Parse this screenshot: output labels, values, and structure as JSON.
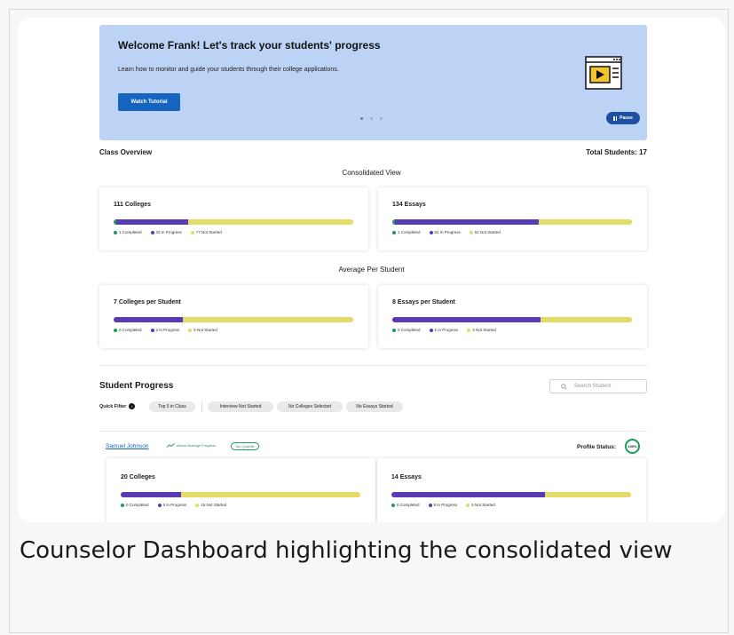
{
  "banner": {
    "title": "Welcome Frank! Let's track your students' progress",
    "text": "Learn how to monitor and guide your students through their college applications.",
    "tutorial_button": "Watch Tutorial",
    "pause_button": "Pause"
  },
  "class_overview": {
    "title": "Class Overview",
    "total_students": "Total Students: 17"
  },
  "consolidated": {
    "heading": "Consolidated View",
    "colleges": {
      "title": "111 Colleges",
      "completed": "1 Completed",
      "in_progress": "33 In Progress",
      "not_started": "77 Not Started",
      "frac_completed": 0.01,
      "frac_in_progress": 0.3
    },
    "essays": {
      "title": "134 Essays",
      "completed": "1 Completed",
      "in_progress": "81 In Progress",
      "not_started": "52 Not Started",
      "frac_completed": 0.01,
      "frac_in_progress": 0.6
    }
  },
  "average": {
    "heading": "Average Per Student",
    "colleges": {
      "title": "7 Colleges per Student",
      "completed": "0 Completed",
      "in_progress": "2 In Progress",
      "not_started": "5 Not Started",
      "frac_completed": 0.0,
      "frac_in_progress": 0.29
    },
    "essays": {
      "title": "8 Essays per Student",
      "completed": "0 Completed",
      "in_progress": "5 In Progress",
      "not_started": "3 Not Started",
      "frac_completed": 0.0,
      "frac_in_progress": 0.62
    }
  },
  "student_progress": {
    "title": "Student Progress",
    "search_placeholder": "Search Student",
    "quick_filter_label": "Quick Filter",
    "filters": [
      "Top 5 in Class",
      "Interview Not Started",
      "No Colleges Selected",
      "No Essays Started"
    ]
  },
  "student": {
    "name": "Samuel Johnson",
    "trend": "Above Average Progress",
    "quartile": "Top Quartile",
    "profile_label": "Profile Status:",
    "profile_value": "100%",
    "colleges": {
      "title": "20 Colleges",
      "completed": "0 Completed",
      "in_progress": "5 In Progress",
      "not_started": "15 Not Started",
      "frac_completed": 0.0,
      "frac_in_progress": 0.25
    },
    "essays": {
      "title": "14 Essays",
      "completed": "0 Completed",
      "in_progress": "9 In Progress",
      "not_started": "5 Not Started",
      "frac_completed": 0.0,
      "frac_in_progress": 0.64
    }
  },
  "caption": "Counselor Dashboard highlighting the consolidated view",
  "colors": {
    "completed": "#1d9b5a",
    "in_progress": "#5a3bb6",
    "not_started": "#e2dc66",
    "banner": "#bcd3f5",
    "primary": "#1565c0"
  }
}
